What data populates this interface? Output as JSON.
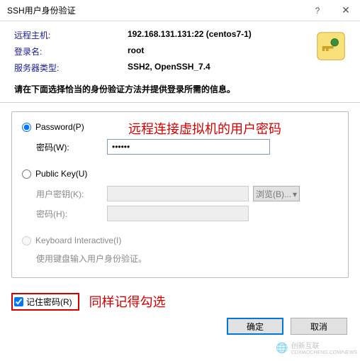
{
  "titlebar": {
    "title": "SSH用户身份验证"
  },
  "info": {
    "host_label": "远程主机:",
    "host_value": "192.168.131.131:22 (centos7-1)",
    "user_label": "登录名:",
    "user_value": "root",
    "server_label": "服务器类型:",
    "server_value": "SSH2, OpenSSH_7.4"
  },
  "instruction": "请在下面选择恰当的身份验证方法并提供登录所需的信息。",
  "auth": {
    "password": {
      "radio_label": "Password(P)",
      "pw_label": "密码(W):",
      "pw_value": "••••••",
      "annotation": "远程连接虚拟机的用户密码"
    },
    "publickey": {
      "radio_label": "Public Key(U)",
      "userkey_label": "用户密钥(K):",
      "browse_label": "浏览(B)...",
      "passphrase_label": "密码(H):"
    },
    "keyboard": {
      "radio_label": "Keyboard Interactive(I)",
      "desc": "使用键盘输入用户身份验证。"
    }
  },
  "remember": {
    "label": "记住密码(R)",
    "annotation": "同样记得勾选"
  },
  "buttons": {
    "ok": "确定",
    "cancel": "取消"
  },
  "watermark": {
    "text1": "创新互联",
    "text2": "CDXIAOCHENG.COM/NEWS"
  }
}
